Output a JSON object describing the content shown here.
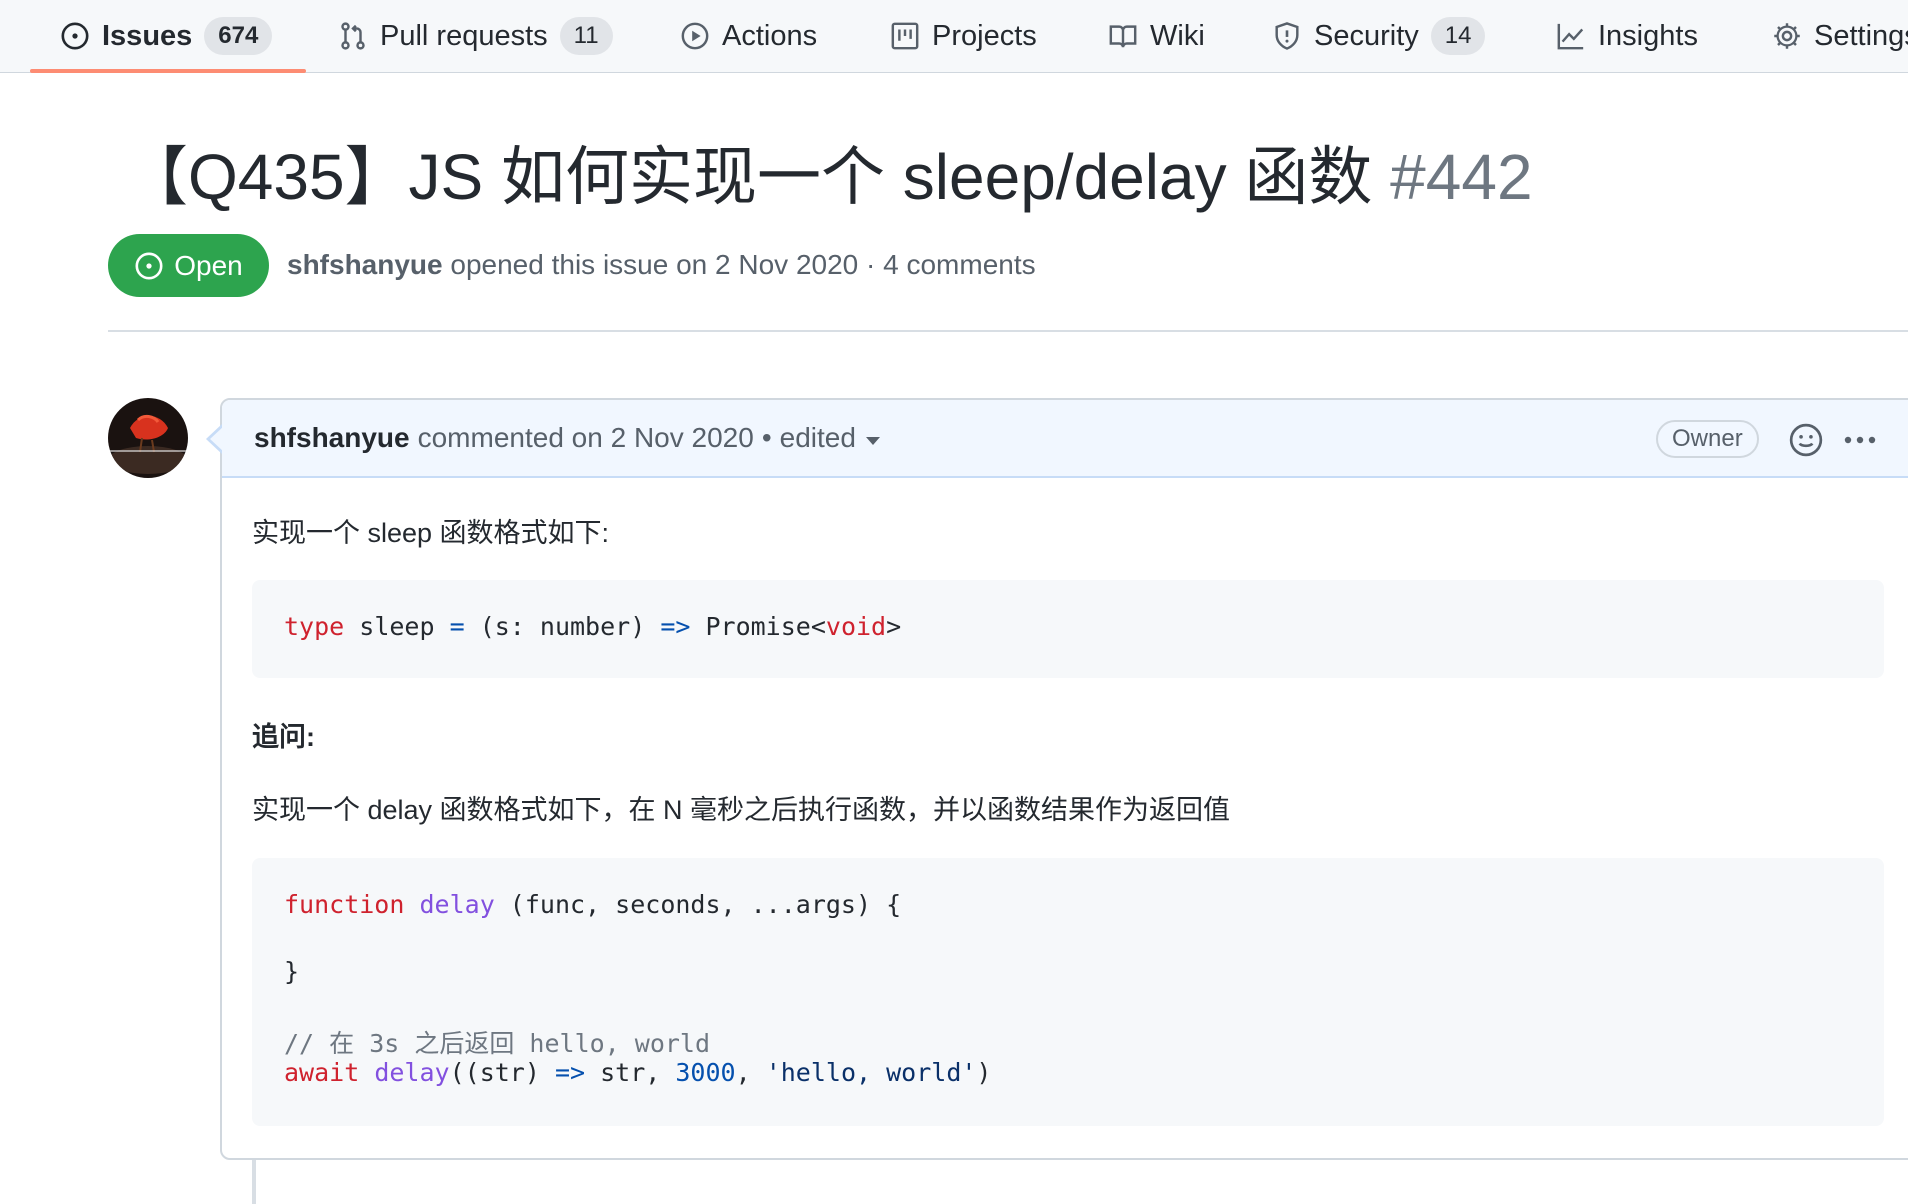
{
  "repo_nav": {
    "tabs": [
      {
        "label": "Issues",
        "count": "674",
        "icon": "issue-opened-icon"
      },
      {
        "label": "Pull requests",
        "count": "11",
        "icon": "git-pull-request-icon"
      },
      {
        "label": "Actions",
        "icon": "play-icon"
      },
      {
        "label": "Projects",
        "icon": "project-icon"
      },
      {
        "label": "Wiki",
        "icon": "book-icon"
      },
      {
        "label": "Security",
        "count": "14",
        "icon": "shield-icon"
      },
      {
        "label": "Insights",
        "icon": "graph-icon"
      },
      {
        "label": "Settings",
        "icon": "gear-icon"
      }
    ],
    "selected_tab": "Issues"
  },
  "issue": {
    "title": "【Q435】JS 如何实现一个 sleep/delay 函数",
    "number": "#442",
    "state": "Open",
    "author": "shfshanyue",
    "meta_text": "opened this issue on 2 Nov 2020 · 4 comments"
  },
  "comment": {
    "author": "shfshanyue",
    "action_text": "commented on 2 Nov 2020",
    "separator": "•",
    "edited_label": "edited",
    "role_badge": "Owner",
    "body": {
      "p1": "实现一个 sleep 函数格式如下:",
      "code1": {
        "t1": "type",
        "t2": " sleep ",
        "t3": "=",
        "t4": " (s: number) ",
        "t5": "=>",
        "t6": " Promise<",
        "t7": "void",
        "t8": ">"
      },
      "followup_heading": "追问:",
      "p2": "实现一个 delay 函数格式如下，在 N 毫秒之后执行函数，并以函数结果作为返回值",
      "code2": {
        "l1_kw": "function",
        "l1_fn": "delay",
        "l1_rest": " (func, seconds, ...args) {",
        "l2": "}",
        "l3_comment": "// 在 3s 之后返回 hello, world",
        "l4_kw": "await",
        "l4_fn": "delay",
        "l4_a": "((str) ",
        "l4_op": "=>",
        "l4_b": " str, ",
        "l4_num": "3000",
        "l4_c": ", ",
        "l4_str": "'hello, world'",
        "l4_d": ")"
      }
    }
  },
  "colors": {
    "open_green": "#2da44e",
    "tab_underline": "#fd8c73",
    "header_blue": "#f1f7ff"
  }
}
